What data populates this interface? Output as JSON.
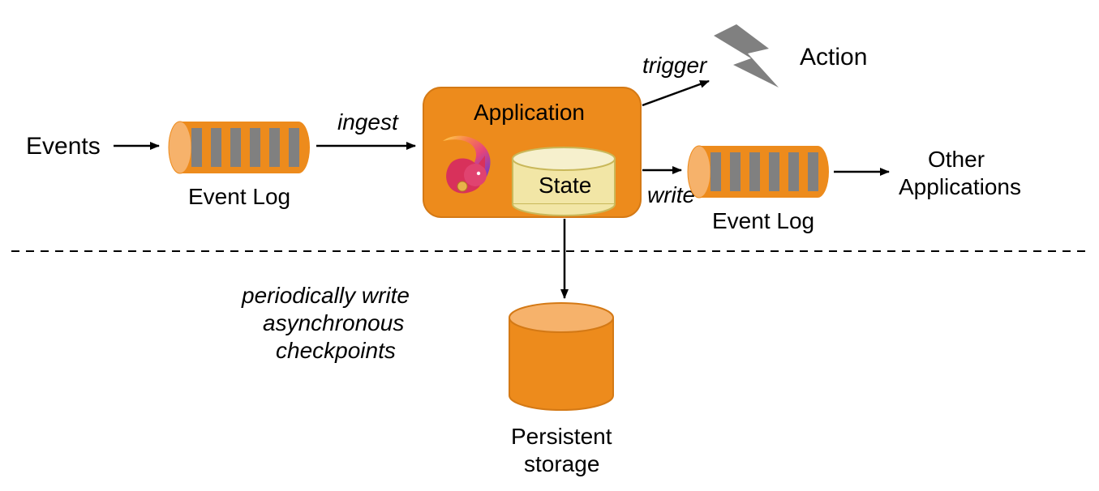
{
  "labels": {
    "events": "Events",
    "event_log_left": "Event Log",
    "ingest": "ingest",
    "application": "Application",
    "state": "State",
    "trigger": "trigger",
    "action": "Action",
    "write": "write",
    "event_log_right": "Event Log",
    "other_apps_line1": "Other",
    "other_apps_line2": "Applications",
    "checkpoint_line1": "periodically write",
    "checkpoint_line2": "asynchronous",
    "checkpoint_line3": "checkpoints",
    "persistent_line1": "Persistent",
    "persistent_line2": "storage"
  },
  "colors": {
    "orange": "#ED8B1C",
    "orange_light": "#F6B26B",
    "yellow": "#F2E6A6",
    "yellow_light": "#F6F0CD",
    "grey": "#808080",
    "dark": "#333333"
  }
}
